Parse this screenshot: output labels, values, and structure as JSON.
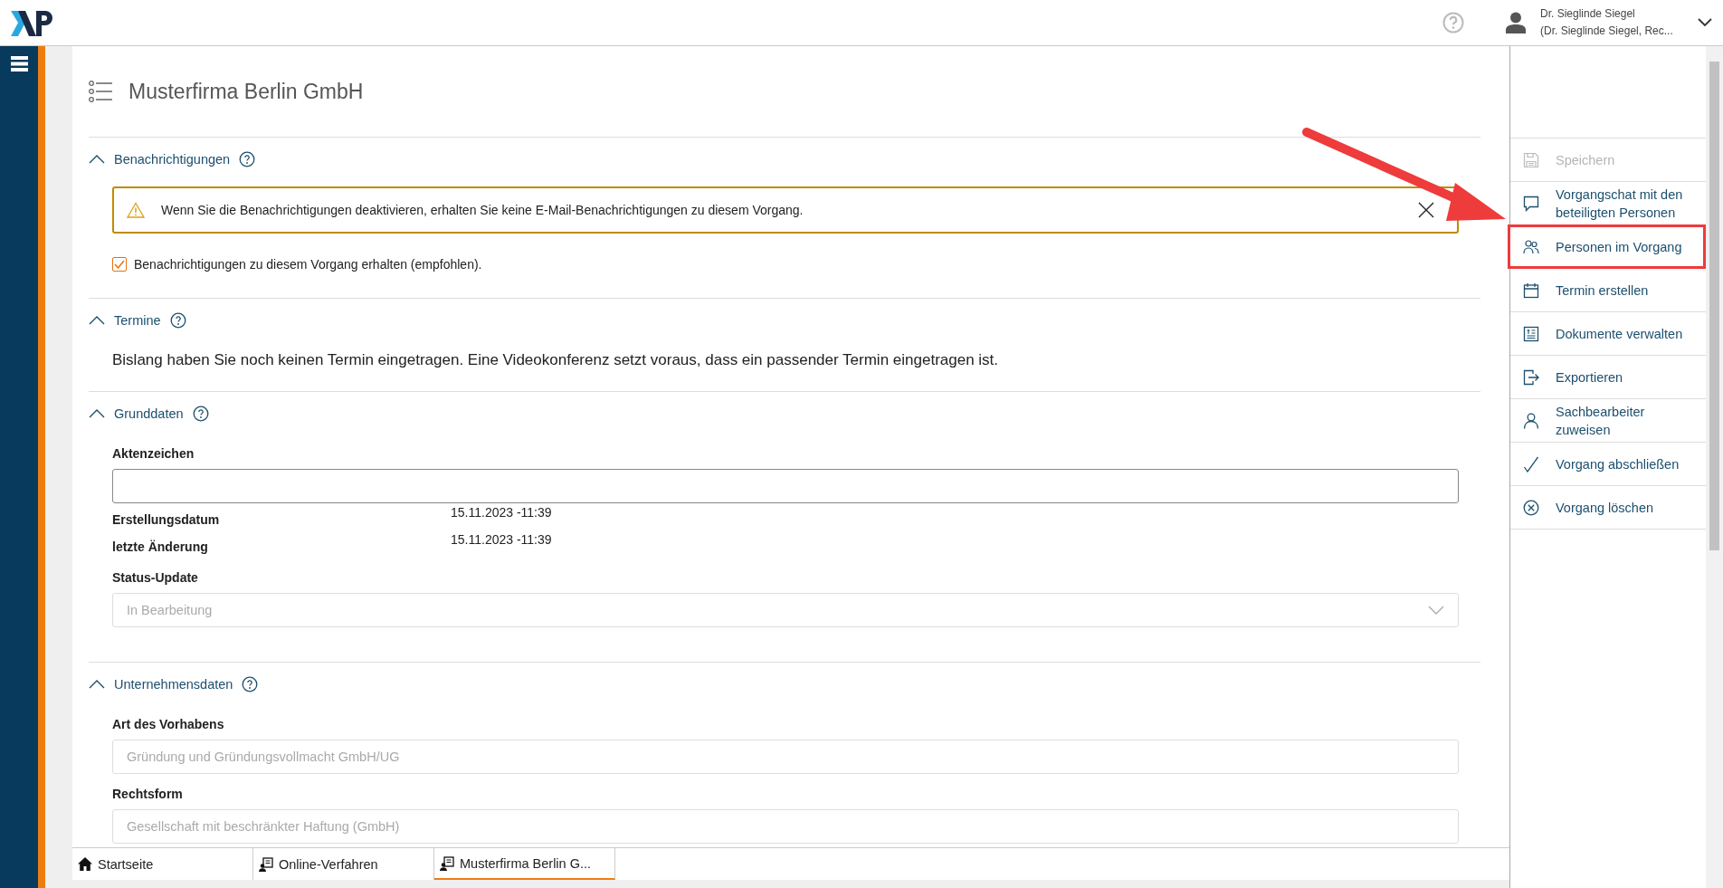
{
  "header": {
    "user_name": "Dr. Sieglinde Siegel",
    "user_role": "(Dr. Sieglinde Siegel, Rec..."
  },
  "title": "Musterfirma Berlin GmbH",
  "sections": [
    {
      "title": "Benachrichtigungen",
      "expanded": true,
      "items": [
        {
          "kind": "alert",
          "text": "Wenn Sie die Benachrichtigungen deaktivieren, erhalten Sie keine E-Mail-Benachrichtigungen zu diesem Vorgang."
        },
        {
          "kind": "checkbox",
          "label": "Benachrichtigungen zu diesem Vorgang erhalten (empfohlen).",
          "checked": true
        }
      ]
    },
    {
      "title": "Termine",
      "expanded": true,
      "items": [
        {
          "kind": "paragraph",
          "text": "Bislang haben Sie noch keinen Termin eingetragen. Eine Videokonferenz setzt voraus, dass ein passender Termin eingetragen ist."
        }
      ]
    },
    {
      "title": "Grunddaten",
      "expanded": true,
      "items": [
        {
          "kind": "input",
          "label": "Aktenzeichen"
        },
        {
          "kind": "info",
          "label": "Erstellungsdatum",
          "value": "15.11.2023 -11:39"
        },
        {
          "kind": "info",
          "label": "letzte Änderung",
          "value": "15.11.2023 -11:39"
        },
        {
          "kind": "select",
          "label": "Status-Update",
          "value": "In Bearbeitung",
          "disabled": true
        }
      ]
    },
    {
      "title": "Unternehmensdaten",
      "expanded": true,
      "items": [
        {
          "kind": "readonly",
          "label": "Art des Vorhabens",
          "value": "Gründung und Gründungsvollmacht GmbH/UG",
          "disabled": true
        },
        {
          "kind": "readonly",
          "label": "Rechtsform",
          "value": "Gesellschaft mit beschränkter Haftung (GmbH)",
          "disabled": true
        }
      ]
    }
  ],
  "actions": [
    {
      "kind": "save",
      "label": "Speichern",
      "disabled": true,
      "highlighted": false
    },
    {
      "kind": "chat",
      "label": "Vorgangschat mit den beteiligten Personen",
      "disabled": false,
      "highlighted": false
    },
    {
      "kind": "people",
      "label": "Personen im Vorgang",
      "disabled": false,
      "highlighted": true
    },
    {
      "kind": "calendar",
      "label": "Termin erstellen",
      "disabled": false,
      "highlighted": false
    },
    {
      "kind": "document",
      "label": "Dokumente verwalten",
      "disabled": false,
      "highlighted": false
    },
    {
      "kind": "export",
      "label": "Exportieren",
      "disabled": false,
      "highlighted": false
    },
    {
      "kind": "person",
      "label": "Sachbearbeiter zuweisen",
      "disabled": false,
      "highlighted": false
    },
    {
      "kind": "check",
      "label": "Vorgang abschließen",
      "disabled": false,
      "highlighted": false
    },
    {
      "kind": "delete",
      "label": "Vorgang löschen",
      "disabled": false,
      "highlighted": false
    }
  ],
  "tabs": [
    {
      "kind": "home",
      "label": "Startseite",
      "selected": false
    },
    {
      "kind": "process",
      "label": "Online-Verfahren",
      "selected": false
    },
    {
      "kind": "process",
      "label": "Musterfirma Berlin G...",
      "selected": true
    }
  ]
}
